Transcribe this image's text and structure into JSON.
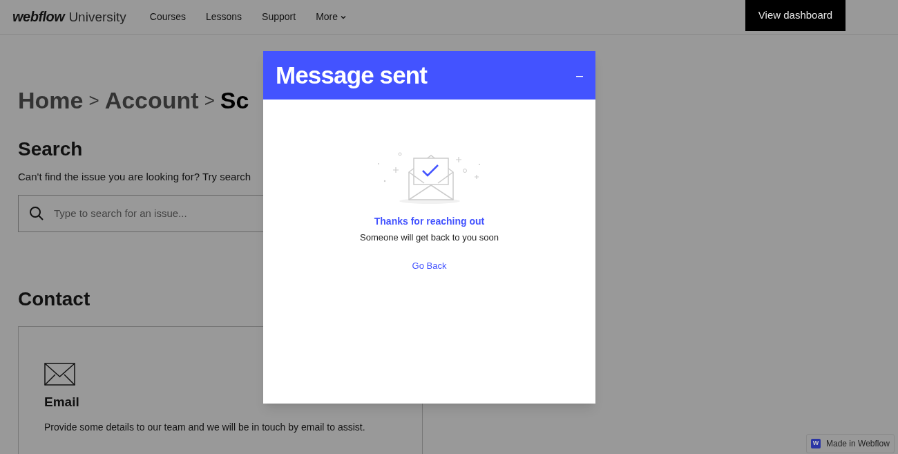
{
  "header": {
    "logo_brand": "webflow",
    "logo_suffix": "University",
    "nav": [
      {
        "label": "Courses",
        "dropdown": false
      },
      {
        "label": "Lessons",
        "dropdown": false
      },
      {
        "label": "Support",
        "dropdown": false
      },
      {
        "label": "More",
        "dropdown": true
      }
    ],
    "cta": "View dashboard"
  },
  "breadcrumb": [
    {
      "label": "Home",
      "current": false
    },
    {
      "label": "Account",
      "current": false
    },
    {
      "label": "Sc",
      "current": true
    }
  ],
  "breadcrumb_separator": ">",
  "search": {
    "heading": "Search",
    "text": "Can't find the issue you are looking for? Try search",
    "placeholder": "Type to search for an issue..."
  },
  "contact": {
    "heading": "Contact",
    "card": {
      "title": "Email",
      "text": "Provide some details to our team and we will be in touch by email to assist."
    }
  },
  "modal": {
    "title": "Message sent",
    "minimize": "–",
    "headline": "Thanks for reaching out",
    "message": "Someone will get back to you soon",
    "link": "Go Back"
  },
  "badge": {
    "logo": "W",
    "text": "Made in Webflow"
  }
}
